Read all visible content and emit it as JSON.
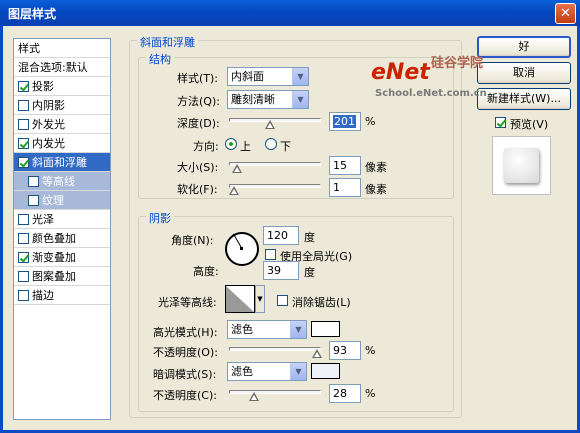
{
  "window": {
    "title": "图层样式",
    "close_glyph": "✕"
  },
  "left_list": {
    "header": "样式",
    "blend": "混合选项:默认",
    "items": [
      {
        "label": "投影",
        "checked": true
      },
      {
        "label": "内阴影",
        "checked": false
      },
      {
        "label": "外发光",
        "checked": false
      },
      {
        "label": "内发光",
        "checked": true
      },
      {
        "label": "斜面和浮雕",
        "checked": true,
        "selected": true
      },
      {
        "label": "等高线",
        "checked": false,
        "sub": true
      },
      {
        "label": "纹理",
        "checked": false,
        "sub": true
      },
      {
        "label": "光泽",
        "checked": false
      },
      {
        "label": "颜色叠加",
        "checked": false
      },
      {
        "label": "渐变叠加",
        "checked": true
      },
      {
        "label": "图案叠加",
        "checked": false
      },
      {
        "label": "描边",
        "checked": false
      }
    ]
  },
  "bevel": {
    "section_title": "斜面和浮雕",
    "structure_title": "结构",
    "style_label": "样式(T):",
    "style_value": "内斜面",
    "method_label": "方法(Q):",
    "method_value": "雕刻清晰",
    "depth_label": "深度(D):",
    "depth_value": "201",
    "depth_unit": "%",
    "direction_label": "方向:",
    "dir_up": "上",
    "dir_down": "下",
    "size_label": "大小(S):",
    "size_value": "15",
    "size_unit": "像素",
    "soften_label": "软化(F):",
    "soften_value": "1",
    "soften_unit": "像素"
  },
  "shading": {
    "title": "阴影",
    "angle_label": "角度(N):",
    "angle_value": "120",
    "angle_unit": "度",
    "global_light_label": "使用全局光(G)",
    "altitude_label": "高度:",
    "altitude_value": "39",
    "altitude_unit": "度",
    "gloss_label": "光泽等高线:",
    "antialias_label": "消除锯齿(L)",
    "highlight_mode_label": "高光模式(H):",
    "highlight_mode_value": "滤色",
    "highlight_opacity_label": "不透明度(O):",
    "highlight_opacity_value": "93",
    "shadow_mode_label": "暗调模式(S):",
    "shadow_mode_value": "滤色",
    "shadow_opacity_label": "不透明度(C):",
    "shadow_opacity_value": "28",
    "percent": "%",
    "highlight_color": "#ffffff",
    "shadow_color": "#eef2f8"
  },
  "buttons": {
    "ok": "好",
    "cancel": "取消",
    "new_style": "新建样式(W)...",
    "preview_label": "预览(V)"
  },
  "watermark": {
    "logo": "eNet",
    "cn": "硅谷学院",
    "url": "School.eNet.com.cn"
  }
}
